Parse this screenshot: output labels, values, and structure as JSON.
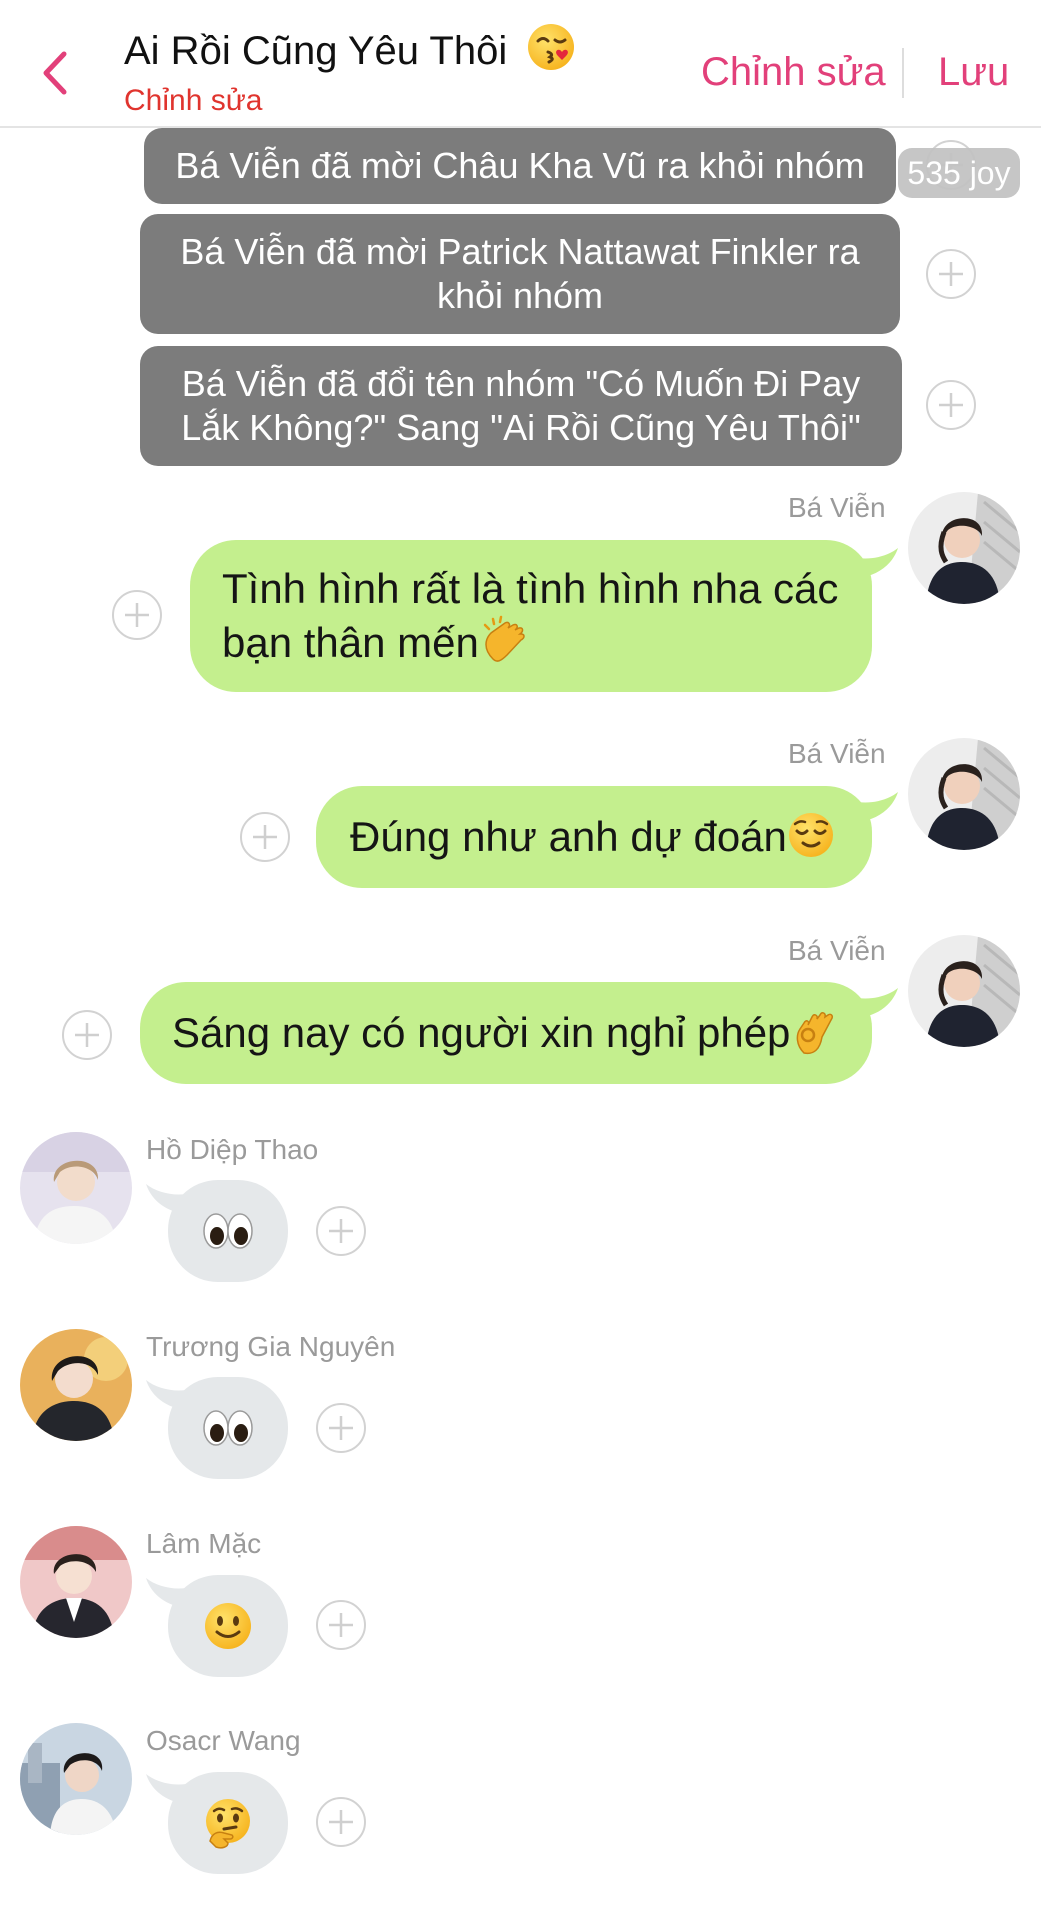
{
  "header": {
    "title": "Ai Rồi Cũng Yêu Thôi",
    "title_emoji": "face-blowing-kiss-emoji",
    "subtitle": "Chỉnh sửa",
    "edit_label": "Chỉnh sửa",
    "save_label": "Lưu"
  },
  "system_messages": [
    {
      "text": "Bá Viễn đã mời Châu Kha Vũ ra khỏi nhóm"
    },
    {
      "text": "Bá Viễn đã mời Patrick Nattawat Finkler ra khỏi nhóm"
    },
    {
      "text": "Bá Viễn đã đổi tên nhóm \"Có Muốn Đi Pay Lắk Không?\" Sang \"Ai Rồi Cũng Yêu Thôi\""
    }
  ],
  "joy_badge": "535 joy",
  "outgoing_messages": [
    {
      "sender": "Bá Viễn",
      "text": "Tình hình rất là tình hình nha các bạn thân mến",
      "emoji": "clapping-hands-emoji"
    },
    {
      "sender": "Bá Viễn",
      "text": "Đúng như anh dự đoán",
      "emoji": "relieved-face-emoji"
    },
    {
      "sender": "Bá Viễn",
      "text": "Sáng nay có người xin nghỉ phép",
      "emoji": "ok-hand-emoji"
    }
  ],
  "incoming_messages": [
    {
      "sender": "Hồ Diệp Thao",
      "emoji": "eyes-emoji"
    },
    {
      "sender": "Trương Gia Nguyên",
      "emoji": "eyes-emoji"
    },
    {
      "sender": "Lâm Mặc",
      "emoji": "slightly-smiling-face-emoji"
    },
    {
      "sender": "Osacr Wang",
      "emoji": "thinking-face-emoji"
    }
  ],
  "colors": {
    "accent": "#e2407a",
    "subtitle_red": "#e0342e",
    "system_bubble": "#7c7c7c",
    "outgoing_bubble": "#c4ef8e",
    "incoming_bubble": "#e5e8ea"
  }
}
